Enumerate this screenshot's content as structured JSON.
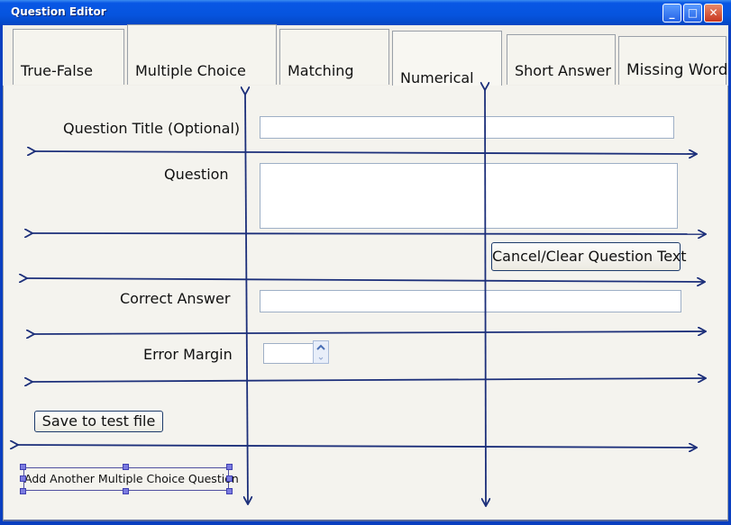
{
  "window": {
    "title": "Question Editor",
    "minimize": "_",
    "maximize": "□",
    "close": "✕"
  },
  "tabs": [
    {
      "label": "True-False"
    },
    {
      "label": "Multiple Choice"
    },
    {
      "label": "Matching"
    },
    {
      "label": "Numerical"
    },
    {
      "label": "Short Answer"
    },
    {
      "label": "Missing Word"
    }
  ],
  "form": {
    "question_title_label": "Question Title (Optional)",
    "question_title_value": "",
    "question_label": "Question",
    "question_value": "",
    "cancel_clear_label": "Cancel/Clear Question Text",
    "correct_answer_label": "Correct Answer",
    "correct_answer_value": "",
    "error_margin_label": "Error Margin",
    "error_margin_value": "",
    "save_label": "Save to test file",
    "add_another_label": "Add Another Multiple Choice Question"
  },
  "icons": {
    "spin_up": "chevron-up-icon",
    "spin_down": "chevron-down-icon"
  }
}
